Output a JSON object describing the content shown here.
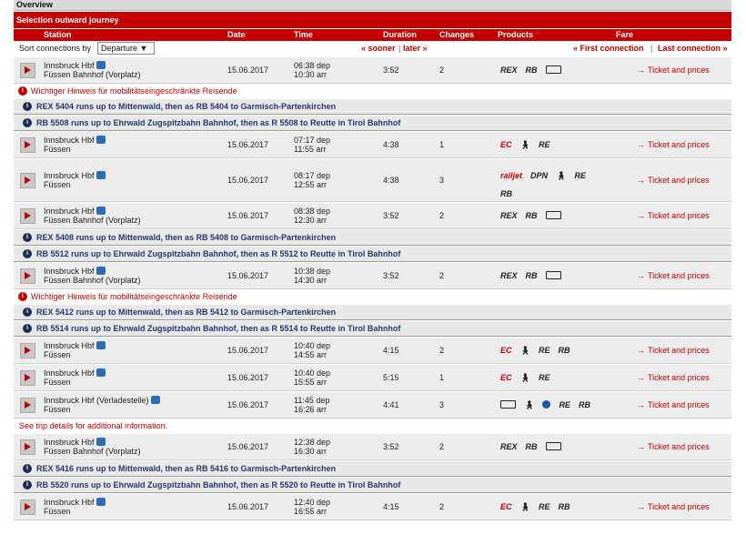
{
  "overview": "Overview",
  "section_title": "Selection outward journey",
  "headers": {
    "station": "Station",
    "date": "Date",
    "time": "Time",
    "duration": "Duration",
    "changes": "Changes",
    "products": "Products",
    "fare": "Fare"
  },
  "sort": {
    "label": "Sort connections by",
    "value": "Departure ▼",
    "sooner": "« sooner",
    "later": "later »",
    "first": "« First connection",
    "last": "Last connection »"
  },
  "fare_label": "Ticket and prices",
  "rows": [
    {
      "type": "conn",
      "from": "Innsbruck Hbf",
      "to": "Füssen Bahnhof (Vorplatz)",
      "date": "15.06.2017",
      "dep": "06:38 dep",
      "arr": "10:30 arr",
      "dur": "3:52",
      "chg": "2",
      "products": [
        "REX",
        "RB",
        "bus"
      ]
    },
    {
      "type": "warn",
      "text": "Wichtiger Hinweis für mobilitätseingeschränkte Reisende"
    },
    {
      "type": "info",
      "text": "REX 5404 runs up to Mittenwald, then as RB 5404 to Garmisch-Partenkirchen"
    },
    {
      "type": "info",
      "text": "RB 5508 runs up to Ehrwald Zugspitzbahn Bahnhof, then as R 5508 to Reutte in Tirol Bahnhof"
    },
    {
      "type": "conn",
      "from": "Innsbruck Hbf",
      "to": "Füssen",
      "date": "15.06.2017",
      "dep": "07:17 dep",
      "arr": "11:55 arr",
      "dur": "4:38",
      "chg": "1",
      "products": [
        "EC",
        "walk",
        "RE"
      ]
    },
    {
      "type": "conn",
      "tall": true,
      "from": "Innsbruck Hbf",
      "to": "Füssen",
      "date": "15.06.2017",
      "dep": "08:17 dep",
      "arr": "12:55 arr",
      "dur": "4:38",
      "chg": "3",
      "products": [
        "railjet",
        "DPN",
        "walk",
        "RE",
        "RB"
      ]
    },
    {
      "type": "conn",
      "from": "Innsbruck Hbf",
      "to": "Füssen Bahnhof (Vorplatz)",
      "date": "15.06.2017",
      "dep": "08:38 dep",
      "arr": "12:30 arr",
      "dur": "3:52",
      "chg": "2",
      "products": [
        "REX",
        "RB",
        "bus"
      ]
    },
    {
      "type": "info",
      "text": "REX 5408 runs up to Mittenwald, then as RB 5408 to Garmisch-Partenkirchen"
    },
    {
      "type": "info",
      "text": "RB 5512 runs up to Ehrwald Zugspitzbahn Bahnhof, then as R 5512 to Reutte in Tirol Bahnhof"
    },
    {
      "type": "conn",
      "from": "Innsbruck Hbf",
      "to": "Füssen Bahnhof (Vorplatz)",
      "date": "15.06.2017",
      "dep": "10:38 dep",
      "arr": "14:30 arr",
      "dur": "3:52",
      "chg": "2",
      "products": [
        "REX",
        "RB",
        "bus"
      ]
    },
    {
      "type": "warn",
      "text": "Wichtiger Hinweis für mobilitätseingeschränkte Reisende"
    },
    {
      "type": "info",
      "text": "REX 5412 runs up to Mittenwald, then as RB 5412 to Garmisch-Partenkirchen"
    },
    {
      "type": "info",
      "text": "RB 5514 runs up to Ehrwald Zugspitzbahn Bahnhof, then as R 5514 to Reutte in Tirol Bahnhof"
    },
    {
      "type": "conn",
      "from": "Innsbruck Hbf",
      "to": "Füssen",
      "date": "15.06.2017",
      "dep": "10:40 dep",
      "arr": "14:55 arr",
      "dur": "4:15",
      "chg": "2",
      "products": [
        "EC",
        "walk",
        "RE",
        "RB"
      ]
    },
    {
      "type": "conn",
      "from": "Innsbruck Hbf",
      "to": "Füssen",
      "date": "15.06.2017",
      "dep": "10:40 dep",
      "arr": "15:55 arr",
      "dur": "5:15",
      "chg": "1",
      "products": [
        "EC",
        "walk",
        "RE"
      ]
    },
    {
      "type": "conn",
      "from": "Innsbruck Hbf (Verladestelle)",
      "to": "Füssen",
      "date": "15.06.2017",
      "dep": "11:45 dep",
      "arr": "16:26 arr",
      "dur": "4:41",
      "chg": "3",
      "products": [
        "bus",
        "walk",
        "S",
        "RE",
        "RB"
      ],
      "noicon": true
    },
    {
      "type": "note",
      "text": "See trip details for additional information."
    },
    {
      "type": "conn",
      "from": "Innsbruck Hbf",
      "to": "Füssen Bahnhof (Vorplatz)",
      "date": "15.06.2017",
      "dep": "12:38 dep",
      "arr": "16:30 arr",
      "dur": "3:52",
      "chg": "2",
      "products": [
        "REX",
        "RB",
        "bus"
      ]
    },
    {
      "type": "info",
      "text": "REX 5416 runs up to Mittenwald, then as RB 5416 to Garmisch-Partenkirchen"
    },
    {
      "type": "info",
      "text": "RB 5520 runs up to Ehrwald Zugspitzbahn Bahnhof, then as R 5520 to Reutte in Tirol Bahnhof"
    },
    {
      "type": "conn",
      "from": "Innsbruck Hbf",
      "to": "Füssen",
      "date": "15.06.2017",
      "dep": "12:40 dep",
      "arr": "16:55 arr",
      "dur": "4:15",
      "chg": "2",
      "products": [
        "EC",
        "walk",
        "RE",
        "RB"
      ]
    }
  ]
}
